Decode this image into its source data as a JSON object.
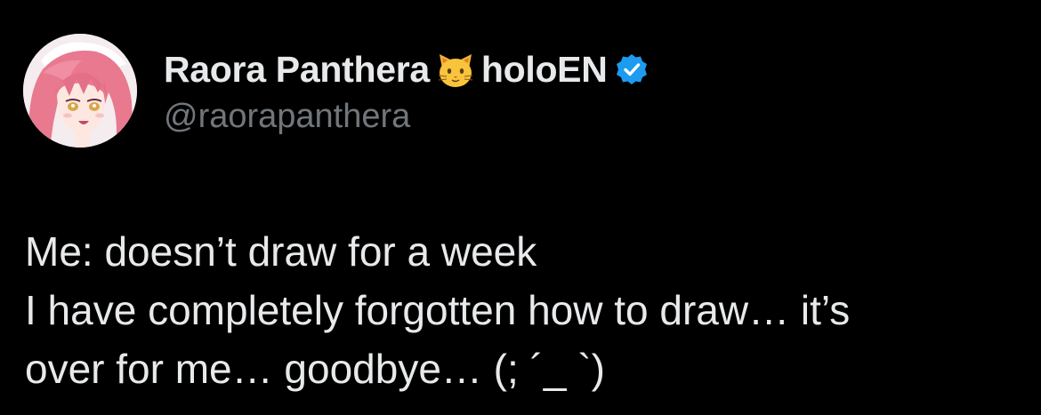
{
  "author": {
    "display_name": "Raora Panthera",
    "name_emoji": "cat-face-icon",
    "affiliation": "holoEN",
    "verified_badge": "verified-icon",
    "handle": "@raorapanthera",
    "avatar": "avatar-portrait"
  },
  "tweet": {
    "lines": [
      "Me: doesn’t draw for a week",
      "I have completely forgotten how to draw… it’s",
      "over for me… goodbye… (; ´_ `)"
    ]
  },
  "colors": {
    "background": "#000000",
    "text_primary": "#e7e9ea",
    "text_secondary": "#71767b",
    "verified_blue": "#1d9bf0"
  }
}
